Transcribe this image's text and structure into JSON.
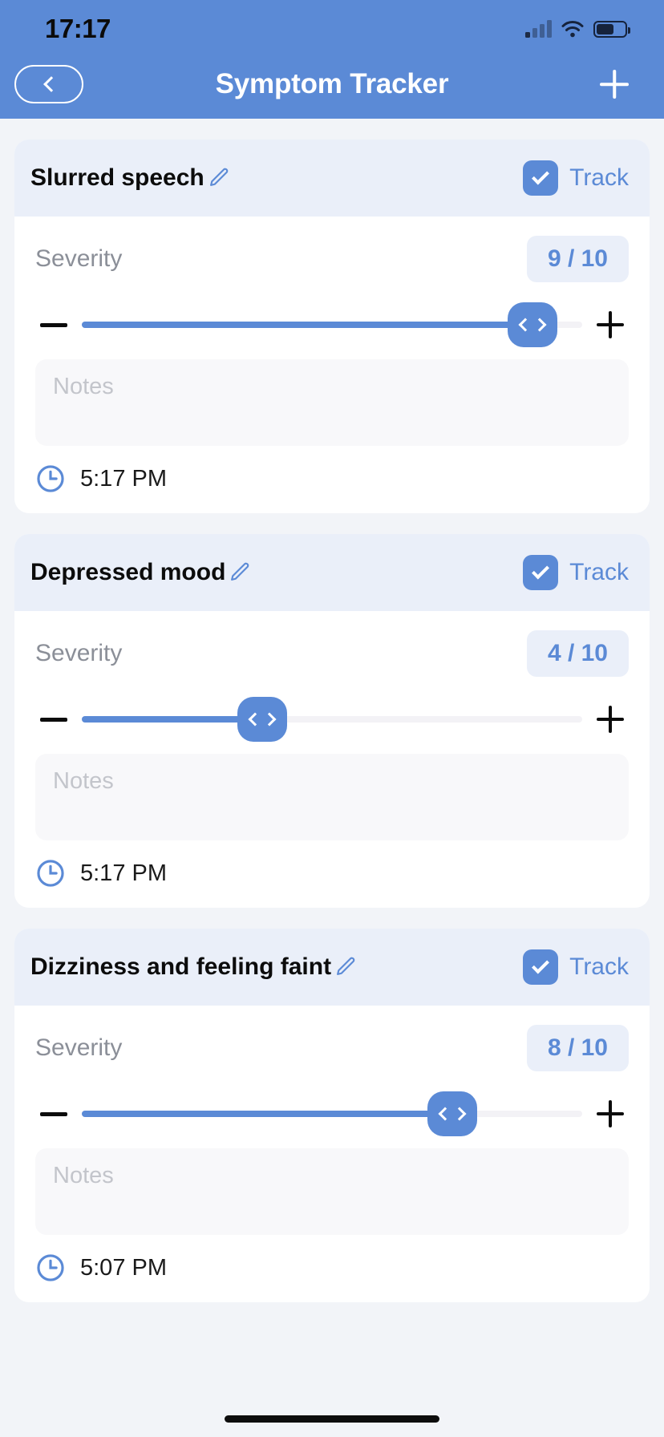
{
  "status_bar": {
    "time": "17:17",
    "signal_icon": "cellular-bars-icon",
    "wifi_icon": "wifi-icon",
    "battery_icon": "battery-icon"
  },
  "nav": {
    "back_icon": "chevron-left-icon",
    "title": "Symptom Tracker",
    "add_icon": "plus-icon"
  },
  "colors": {
    "brand": "#5b8ad6",
    "card_header": "#eaeff9",
    "page_bg": "#f2f4f8",
    "badge_text": "#5b8ad6"
  },
  "labels": {
    "severity": "Severity",
    "track": "Track",
    "notes_placeholder": "Notes",
    "edit_icon": "pencil-icon",
    "clock_icon": "clock-icon",
    "decrement_icon": "minus-icon",
    "increment_icon": "plus-icon",
    "checkbox_icon": "check-icon",
    "slider_thumb_icon": "left-right-chevrons-icon"
  },
  "symptoms": [
    {
      "name": "Slurred speech",
      "tracked": true,
      "severity": 9,
      "severity_max": 10,
      "severity_display": "9 / 10",
      "notes": "",
      "time": "5:17 PM"
    },
    {
      "name": "Depressed mood",
      "tracked": true,
      "severity": 4,
      "severity_max": 10,
      "severity_display": "4 / 10",
      "notes": "",
      "time": "5:17 PM"
    },
    {
      "name": "Dizziness and feeling faint",
      "tracked": true,
      "severity": 8,
      "severity_max": 10,
      "severity_display": "8 / 10",
      "notes": "",
      "time": "5:07 PM"
    }
  ]
}
